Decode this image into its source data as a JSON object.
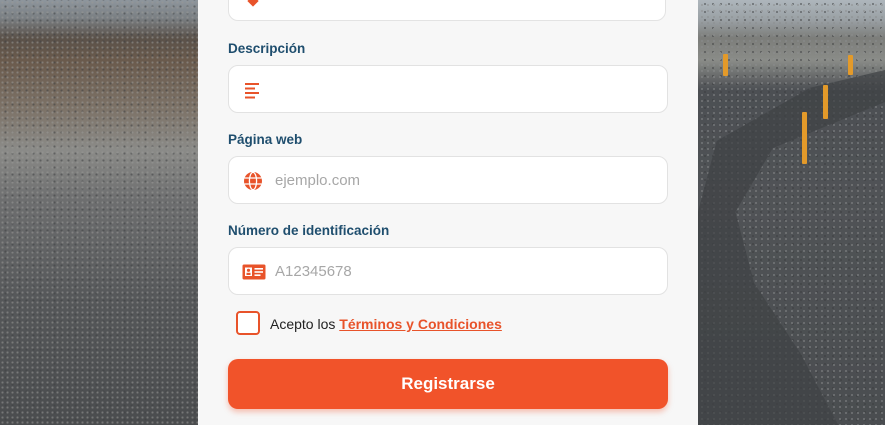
{
  "form": {
    "fields": [
      {
        "label": "Descripción",
        "placeholder": "",
        "icon": "text-align-icon"
      },
      {
        "label": "Página web",
        "placeholder": "ejemplo.com",
        "icon": "globe-icon"
      },
      {
        "label": "Número de identificación",
        "placeholder": "A12345678",
        "icon": "id-card-icon"
      }
    ],
    "terms": {
      "prefix": "Acepto los ",
      "link": "Términos y Condiciones"
    },
    "submit_label": "Registrarse"
  },
  "colors": {
    "accent": "#f1532a",
    "label": "#1f4e6e",
    "card": "#f7f7f7"
  }
}
